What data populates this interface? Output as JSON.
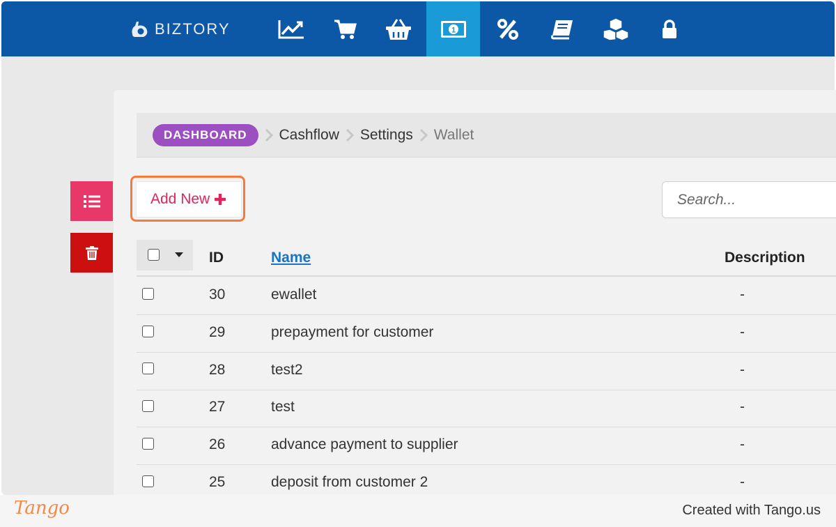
{
  "brand": {
    "name": "BIZTORY"
  },
  "nav": {
    "items": [
      {
        "icon": "chart-line-icon",
        "active": false
      },
      {
        "icon": "cart-icon",
        "active": false
      },
      {
        "icon": "basket-icon",
        "active": false
      },
      {
        "icon": "money-icon",
        "active": true
      },
      {
        "icon": "percent-icon",
        "active": false
      },
      {
        "icon": "book-icon",
        "active": false
      },
      {
        "icon": "boxes-icon",
        "active": false
      },
      {
        "icon": "lock-icon",
        "active": false
      }
    ]
  },
  "breadcrumb": {
    "home": "DASHBOARD",
    "items": [
      "Cashflow",
      "Settings",
      "Wallet"
    ]
  },
  "sidebar_actions": {
    "list_icon": "list-icon",
    "delete_icon": "trash-icon"
  },
  "toolbar": {
    "add_new_label": "Add New",
    "search_placeholder": "Search..."
  },
  "table": {
    "columns": {
      "id": "ID",
      "name": "Name",
      "description": "Description"
    },
    "rows": [
      {
        "id": "30",
        "name": "ewallet",
        "description": "-"
      },
      {
        "id": "29",
        "name": "prepayment for customer",
        "description": "-"
      },
      {
        "id": "28",
        "name": "test2",
        "description": "-"
      },
      {
        "id": "27",
        "name": "test",
        "description": "-"
      },
      {
        "id": "26",
        "name": "advance payment to supplier",
        "description": "-"
      },
      {
        "id": "25",
        "name": "deposit from customer 2",
        "description": "-"
      }
    ]
  },
  "footer": {
    "logo": "Tango",
    "credit": "Created with Tango.us"
  },
  "colors": {
    "navbar": "#0d57a7",
    "nav_active": "#1a9ad7",
    "dashboard_badge": "#9b4fc0",
    "add_new_text": "#e0245e",
    "highlight": "#f47b3c",
    "list_button": "#e8386a",
    "delete_button": "#cc1010"
  }
}
